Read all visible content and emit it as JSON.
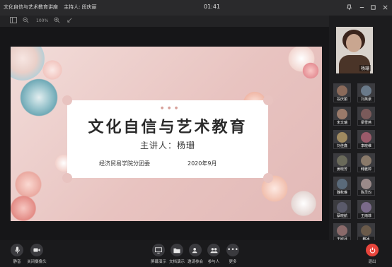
{
  "window": {
    "title": "文化自信与艺术教育讲座",
    "host": "主持人: 段庆丽",
    "clock": "01:41"
  },
  "toolbar": {
    "zoom": "100%"
  },
  "slide": {
    "title": "文化自信与艺术教育",
    "speaker": "主讲人：杨珊",
    "org": "经济贸易学院分团委",
    "date": "2020年9月"
  },
  "host_video": {
    "name": "杨珊"
  },
  "participants": [
    {
      "name": "段庆丽",
      "color": "#8a6a5a"
    },
    {
      "name": "刘英豪",
      "color": "#6a7a8a"
    },
    {
      "name": "宋文瑞",
      "color": "#9a7a6a"
    },
    {
      "name": "梁雪燕",
      "color": "#7a5a5a"
    },
    {
      "name": "刘佳鑫",
      "color": "#a08a60"
    },
    {
      "name": "李晓维",
      "color": "#9a5a6a"
    },
    {
      "name": "姜晓芳",
      "color": "#6a6a5a"
    },
    {
      "name": "韩雅婷",
      "color": "#8a7a6a"
    },
    {
      "name": "魏秋琳",
      "color": "#5a6a7a"
    },
    {
      "name": "陈灵均",
      "color": "#9a8a8a"
    },
    {
      "name": "蔡晓航",
      "color": "#5a5a6a"
    },
    {
      "name": "王雨菲",
      "color": "#7a6a8a"
    },
    {
      "name": "王欣月",
      "color": "#8a6a6a"
    },
    {
      "name": "韩冰",
      "color": "#6a5a4a"
    }
  ],
  "controls": {
    "mute": "静音",
    "camera": "关闭摄像头",
    "screen_share": "屏幕演示",
    "doc_share": "文档演示",
    "invite": "邀请参会",
    "participants": "参与人",
    "more": "更多",
    "exit": "退出"
  }
}
